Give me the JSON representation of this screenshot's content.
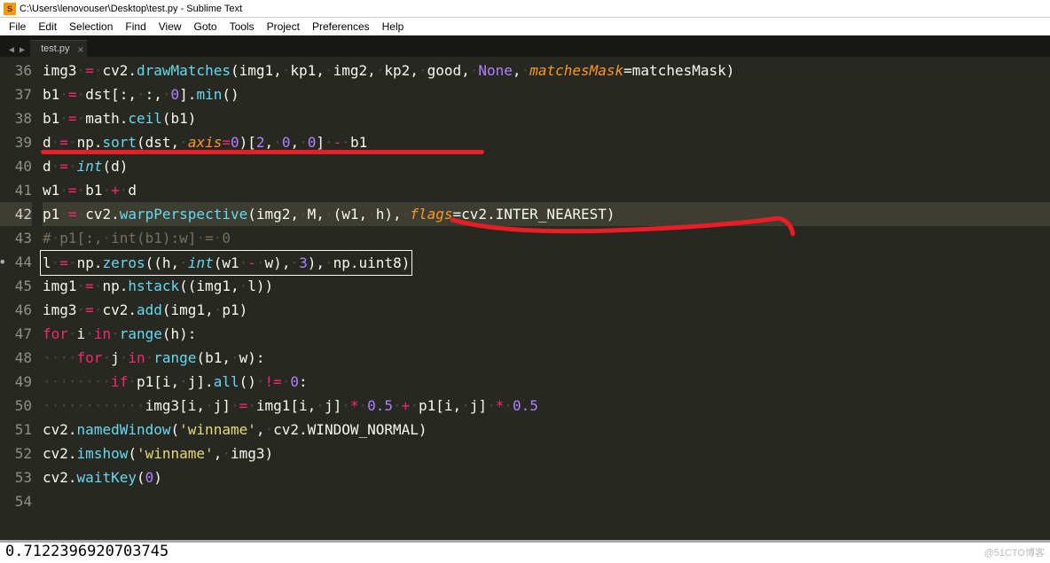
{
  "window": {
    "title": "C:\\Users\\lenovouser\\Desktop\\test.py - Sublime Text"
  },
  "menu": {
    "file": "File",
    "edit": "Edit",
    "selection": "Selection",
    "find": "Find",
    "view": "View",
    "goto": "Goto",
    "tools": "Tools",
    "project": "Project",
    "preferences": "Preferences",
    "help": "Help"
  },
  "tab": {
    "name": "test.py"
  },
  "gutter": {
    "start": 36,
    "end": 54,
    "current": 42,
    "modified": 44
  },
  "code": {
    "l36": {
      "a": "img3",
      "b": "cv2",
      "c": "drawMatches",
      "d": "(img1,",
      "e": "kp1,",
      "f": "img2,",
      "g": "kp2,",
      "h": "good,",
      "i": "None",
      "j": ",",
      "k": "matchesMask",
      "l": "=matchesMask)"
    },
    "l37": {
      "a": "b1",
      "b": "dst[:,",
      "c": ":,",
      "d": "0",
      "e": "].",
      "f": "min",
      "g": "()"
    },
    "l38": {
      "a": "b1",
      "b": "math",
      "c": "ceil",
      "d": "(b1)"
    },
    "l39": {
      "a": "d",
      "b": "np",
      "c": "sort",
      "d": "(dst,",
      "e": "axis",
      "f": "=",
      "g": "0",
      "h": ")[",
      "i": "2",
      "j": ",",
      "k": "0",
      "l": ",",
      "m": "0",
      "n": "]",
      "o": "b1"
    },
    "l40": {
      "a": "d",
      "b": "int",
      "c": "(d)"
    },
    "l41": {
      "a": "w1",
      "b": "b1",
      "c": "d"
    },
    "l42": {
      "a": "p1",
      "b": "cv2",
      "c": "warpPerspective",
      "d": "(img2,",
      "e": "M,",
      "f": "(w1,",
      "g": "h),",
      "h": "flags",
      "i": "=cv2.INTER_NEAREST)"
    },
    "l43": {
      "a": "#",
      "b": "p1[:,",
      "c": "int(b1):w]",
      "d": "=",
      "e": "0"
    },
    "l44": {
      "a": "l",
      "b": "np",
      "c": "zeros",
      "d": "((h,",
      "e": "int",
      "f": "(w1",
      "g": "w),",
      "h": "3",
      "i": "),",
      "j": "np.uint8)"
    },
    "l45": {
      "a": "img1",
      "b": "np",
      "c": "hstack",
      "d": "((img1,",
      "e": "l))"
    },
    "l46": {
      "a": "img3",
      "b": "cv2",
      "c": "add",
      "d": "(img1,",
      "e": "p1)"
    },
    "l47": {
      "a": "for",
      "b": "i",
      "c": "in",
      "d": "range",
      "e": "(h):"
    },
    "l48": {
      "a": "for",
      "b": "j",
      "c": "in",
      "d": "range",
      "e": "(b1,",
      "f": "w):"
    },
    "l49": {
      "a": "if",
      "b": "p1[i,",
      "c": "j].",
      "d": "all",
      "e": "()",
      "f": "!=",
      "g": "0",
      "h": ":"
    },
    "l50": {
      "a": "img3[i,",
      "b": "j]",
      "c": "img1[i,",
      "d": "j]",
      "e": "0.5",
      "f": "p1[i,",
      "g": "j]",
      "h": "0.5"
    },
    "l51": {
      "a": "cv2",
      "b": "namedWindow",
      "c": "(",
      "d": "'winname'",
      "e": ",",
      "f": "cv2.WINDOW_NORMAL)"
    },
    "l52": {
      "a": "cv2",
      "b": "imshow",
      "c": "(",
      "d": "'winname'",
      "e": ",",
      "f": "img3)"
    },
    "l53": {
      "a": "cv2",
      "b": "waitKey",
      "c": "(",
      "d": "0",
      "e": ")"
    }
  },
  "status": {
    "text": "0.7122396920703745"
  },
  "watermark": {
    "text": "@51CTO博客"
  }
}
